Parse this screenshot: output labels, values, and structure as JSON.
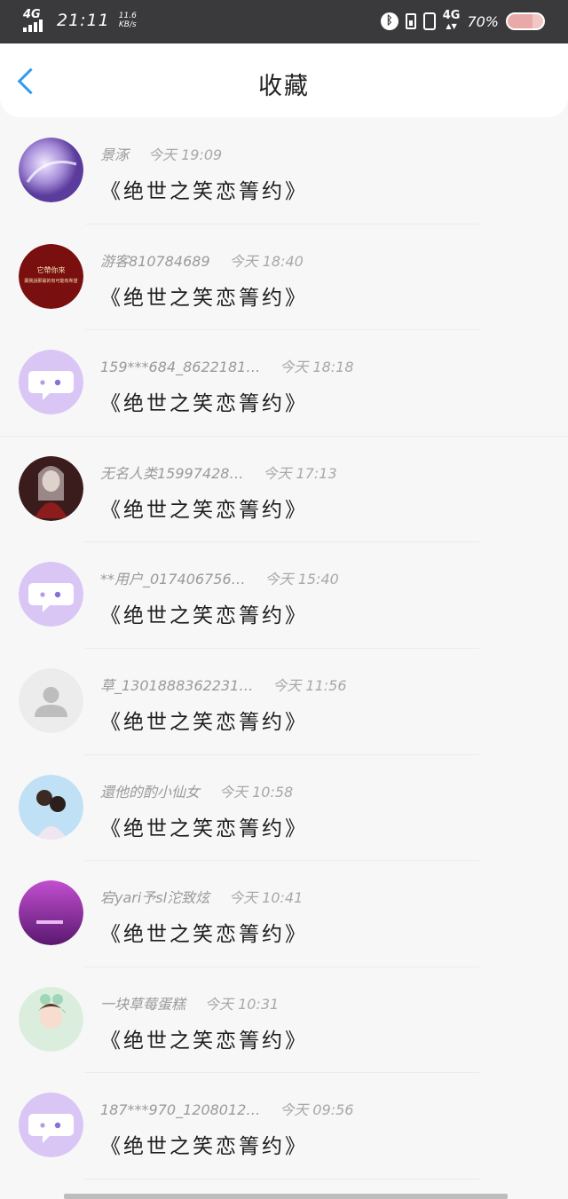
{
  "status_bar": {
    "network": "4G",
    "time": "21:11",
    "speed_value": "11.6",
    "speed_unit": "KB/s",
    "net_type": "4G",
    "battery": "70%",
    "battery_level": 0.7
  },
  "header": {
    "title": "收藏"
  },
  "favorites": [
    {
      "user": "景涿",
      "time": "今天 19:09",
      "book": "《绝世之笑恋箐约》",
      "avatar": "art-purple"
    },
    {
      "user": "游客810784689",
      "time": "今天 18:40",
      "book": "《绝世之笑恋箐约》",
      "avatar": "red-text",
      "avatar_text_1": "它帶你來",
      "avatar_text_2": "願我說那最的有可能有希望"
    },
    {
      "user": "159***684_8622181…",
      "time": "今天 18:18",
      "book": "《绝世之笑恋箐约》",
      "avatar": "chat-bubble"
    },
    {
      "user": "无名人类15997428…",
      "time": "今天 17:13",
      "book": "《绝世之笑恋箐约》",
      "avatar": "art-dark"
    },
    {
      "user": "**用户_017406756…",
      "time": "今天 15:40",
      "book": "《绝世之笑恋箐约》",
      "avatar": "chat-bubble"
    },
    {
      "user": "草_1301888362231…",
      "time": "今天 11:56",
      "book": "《绝世之笑恋箐约》",
      "avatar": "default-user"
    },
    {
      "user": "還他的酌小仙女",
      "time": "今天 10:58",
      "book": "《绝世之笑恋箐约》",
      "avatar": "art-couple"
    },
    {
      "user": "宕yari予sl沱致炫",
      "time": "今天 10:41",
      "book": "《绝世之笑恋箐约》",
      "avatar": "art-violet"
    },
    {
      "user": "一块草莓蛋糕",
      "time": "今天 10:31",
      "book": "《绝世之笑恋箐约》",
      "avatar": "art-girl"
    },
    {
      "user": "187***970_1208012…",
      "time": "今天 09:56",
      "book": "《绝世之笑恋箐约》",
      "avatar": "chat-bubble"
    }
  ]
}
